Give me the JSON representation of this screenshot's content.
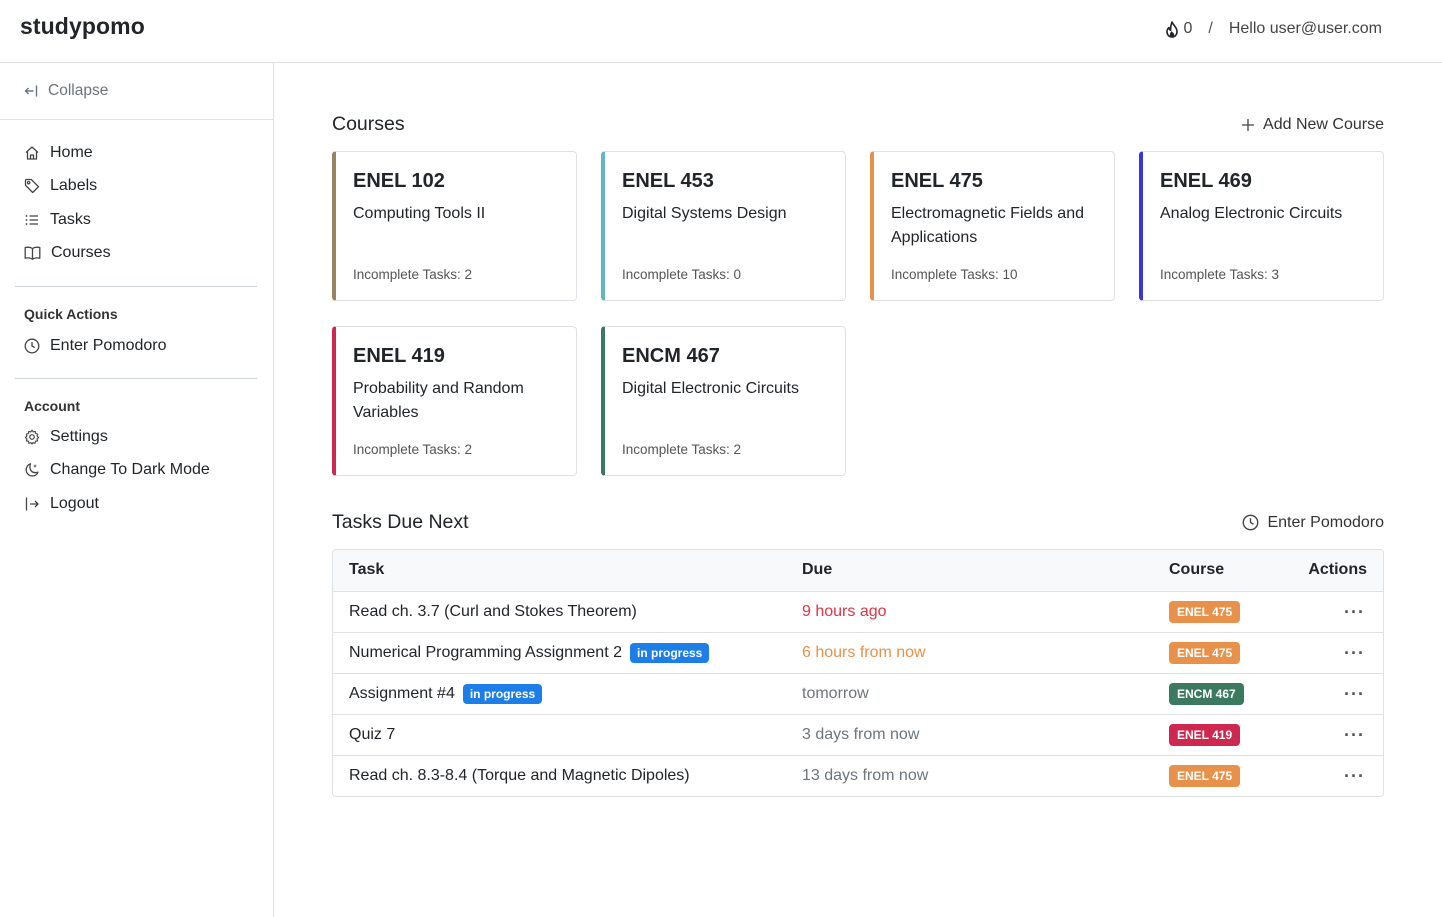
{
  "header": {
    "brand": "studypomo",
    "streak_count": "0",
    "separator": "/",
    "greeting": "Hello user@user.com"
  },
  "sidebar": {
    "collapse_label": "Collapse",
    "nav": [
      {
        "label": "Home",
        "icon": "home-icon"
      },
      {
        "label": "Labels",
        "icon": "tag-icon"
      },
      {
        "label": "Tasks",
        "icon": "list-icon"
      },
      {
        "label": "Courses",
        "icon": "book-icon"
      }
    ],
    "quick_actions_title": "Quick Actions",
    "quick_actions": [
      {
        "label": "Enter Pomodoro",
        "icon": "clock-icon"
      }
    ],
    "account_title": "Account",
    "account": [
      {
        "label": "Settings",
        "icon": "gear-icon"
      },
      {
        "label": "Change To Dark Mode",
        "icon": "moon-icon"
      },
      {
        "label": "Logout",
        "icon": "logout-icon"
      }
    ]
  },
  "courses": {
    "title": "Courses",
    "add_label": "Add New Course",
    "items": [
      {
        "code": "ENEL 102",
        "name": "Computing Tools II",
        "count": "Incomplete Tasks: 2",
        "color": "#9a8460"
      },
      {
        "code": "ENEL 453",
        "name": "Digital Systems Design",
        "count": "Incomplete Tasks: 0",
        "color": "#62b8c2"
      },
      {
        "code": "ENEL 475",
        "name": "Electromagnetic Fields and Applications",
        "count": "Incomplete Tasks: 10",
        "color": "#e8914a"
      },
      {
        "code": "ENEL 469",
        "name": "Analog Electronic Circuits",
        "count": "Incomplete Tasks: 3",
        "color": "#3a35d9"
      },
      {
        "code": "ENEL 419",
        "name": "Probability and Random Variables",
        "count": "Incomplete Tasks: 2",
        "color": "#cf2850"
      },
      {
        "code": "ENCM 467",
        "name": "Digital Electronic Circuits",
        "count": "Incomplete Tasks: 2",
        "color": "#3b7a5e"
      }
    ]
  },
  "tasks": {
    "title": "Tasks Due Next",
    "pomodoro_label": "Enter Pomodoro",
    "columns": {
      "task": "Task",
      "due": "Due",
      "course": "Course",
      "actions": "Actions"
    },
    "rows": [
      {
        "task": "Read ch. 3.7 (Curl and Stokes Theorem)",
        "status": "",
        "due": "9 hours ago",
        "due_color": "#dc3545",
        "course": "ENEL 475",
        "course_color": "#e8914a"
      },
      {
        "task": "Numerical Programming Assignment 2",
        "status": "in progress",
        "due": "6 hours from now",
        "due_color": "#e8914a",
        "course": "ENEL 475",
        "course_color": "#e8914a"
      },
      {
        "task": "Assignment #4",
        "status": "in progress",
        "due": "tomorrow",
        "due_color": "#6c757d",
        "course": "ENCM 467",
        "course_color": "#3b7a5e"
      },
      {
        "task": "Quiz 7",
        "status": "",
        "due": "3 days from now",
        "due_color": "#6c757d",
        "course": "ENEL 419",
        "course_color": "#cf2850"
      },
      {
        "task": "Read ch. 8.3-8.4 (Torque and Magnetic Dipoles)",
        "status": "",
        "due": "13 days from now",
        "due_color": "#6c757d",
        "course": "ENEL 475",
        "course_color": "#e8914a"
      }
    ],
    "actions_glyph": "···"
  }
}
